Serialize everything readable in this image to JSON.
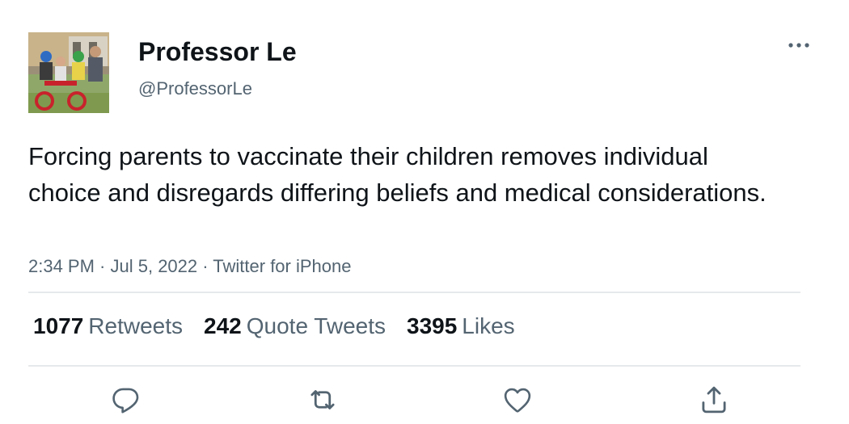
{
  "author": {
    "display_name": "Professor Le",
    "handle": "@ProfessorLe",
    "avatar_icon": "family-photo-avatar"
  },
  "tweet": {
    "text": "Forcing parents to vaccinate their children removes individual choice and disregards differing beliefs and medical considerations.",
    "time": "2:34 PM",
    "date": "Jul 5, 2022",
    "source": "Twitter for iPhone",
    "separator": " · "
  },
  "stats": {
    "retweets": {
      "count": "1077",
      "label": "Retweets"
    },
    "quote_tweets": {
      "count": "242",
      "label": "Quote Tweets"
    },
    "likes": {
      "count": "3395",
      "label": "Likes"
    }
  },
  "actions": {
    "reply_icon": "reply-icon",
    "retweet_icon": "retweet-icon",
    "like_icon": "heart-icon",
    "share_icon": "share-icon",
    "more_icon": "more-icon"
  },
  "colors": {
    "primary_text": "#0f1419",
    "secondary_text": "#536471",
    "divider": "#e6e9ec"
  }
}
